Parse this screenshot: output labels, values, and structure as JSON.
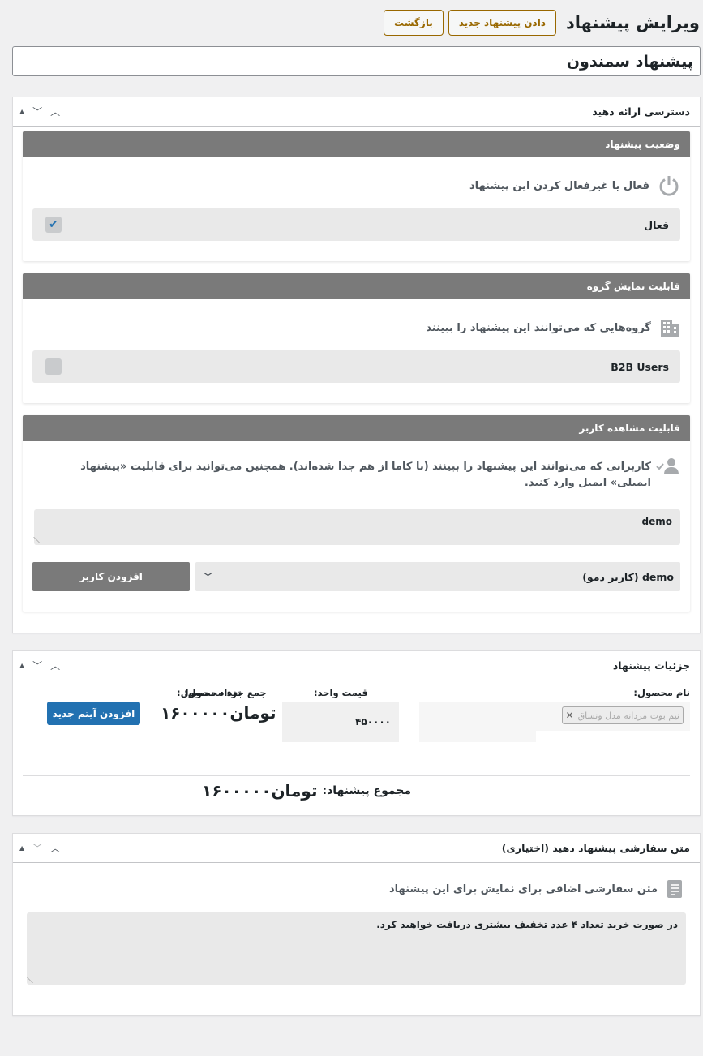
{
  "header": {
    "title": "ویرایش پیشنهاد",
    "new_offer_label": "دادن پیشنهاد جدید",
    "back_label": "بازگشت"
  },
  "offer_title": "پیشنهاد سمندون",
  "access_box": {
    "title": "دسترسی ارائه دهید",
    "status_card": {
      "header": "وضعیت پیشنهاد",
      "description": "فعال یا غیرفعال کردن این پیشنهاد",
      "option_label": "فعال",
      "checked": true
    },
    "group_card": {
      "header": "قابلیت نمایش گروه",
      "description": "گروه‌هایی که می‌توانند این پیشنهاد را ببینند",
      "option_label": "B2B Users",
      "checked": false
    },
    "user_card": {
      "header": "قابلیت مشاهده کاربر",
      "description": "کاربرانی که می‌توانند این پیشنهاد را ببینند (با کاما از هم جدا شده‌اند). همچنین می‌توانید برای قابلیت «پیشنهاد ایمیلی» ایمیل وارد کنید.",
      "users_value": "demo",
      "select_value": "demo (کاربر دمو)",
      "add_user_label": "افزودن کاربر"
    }
  },
  "details_box": {
    "title": "جزئیات پیشنهاد",
    "product_name_label": "نام محصول:",
    "product_tag": "نیم بوت مردانه مدل ونساق",
    "quantity_label": "تعداد محصول:",
    "unit_price_label": "قیمت واحد:",
    "unit_price_value": "۴۵۰۰۰۰",
    "subtotal_label": "جمع جزء محصول:",
    "subtotal_value": "تومان۱۶۰۰۰۰۰",
    "add_item_label": "افزودن آیتم جدید",
    "total_label": "مجموع پیشنهاد:",
    "total_value": "تومان۱۶۰۰۰۰۰"
  },
  "custom_text_box": {
    "title": "متن سفارشی پیشنهاد دهید (اختیاری)",
    "description": "متن سفارشی اضافی برای نمایش برای این پیشنهاد",
    "text_value": "در صورت خرید تعداد ۴ عدد تخفیف بیشتری دریافت خواهید کرد."
  },
  "colors": {
    "accent": "#2271b1",
    "card_header": "#7a7a7a",
    "header_button": "#996800"
  }
}
